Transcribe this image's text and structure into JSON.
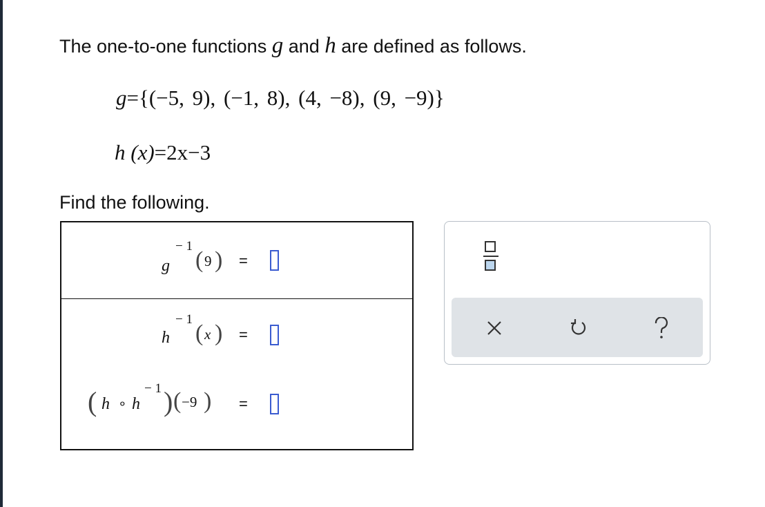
{
  "intro": {
    "pre": "The one-to-one functions ",
    "g": "g",
    "and": " and ",
    "h": "h",
    "post": " are defined as follows."
  },
  "definitions": {
    "g_name": "g",
    "g_set": "={(−5, 9), (−1, 8), (4, −8), (9, −9)}",
    "h_name": "h",
    "h_arg": "(x)",
    "h_rhs": "=2x−3"
  },
  "prompt": "Find the following.",
  "questions": [
    {
      "fn": "g",
      "exp": "− 1",
      "arg": "9",
      "equals": "="
    },
    {
      "fn": "h",
      "exp": "− 1",
      "arg": "x",
      "equals": "="
    },
    {
      "fn_left": "h",
      "compose": "∘",
      "fn_right": "h",
      "exp": "− 1",
      "arg": "−9",
      "equals": "="
    }
  ],
  "toolbar": {
    "fraction_icon": "fraction-icon",
    "clear_icon": "x-icon",
    "undo_icon": "undo-icon",
    "help_icon": "question-icon"
  },
  "colors": {
    "answer_box": "#3a5bd0",
    "toolbar_bg": "#dfe3e7",
    "fraction_fill": "#bcd6ee"
  }
}
